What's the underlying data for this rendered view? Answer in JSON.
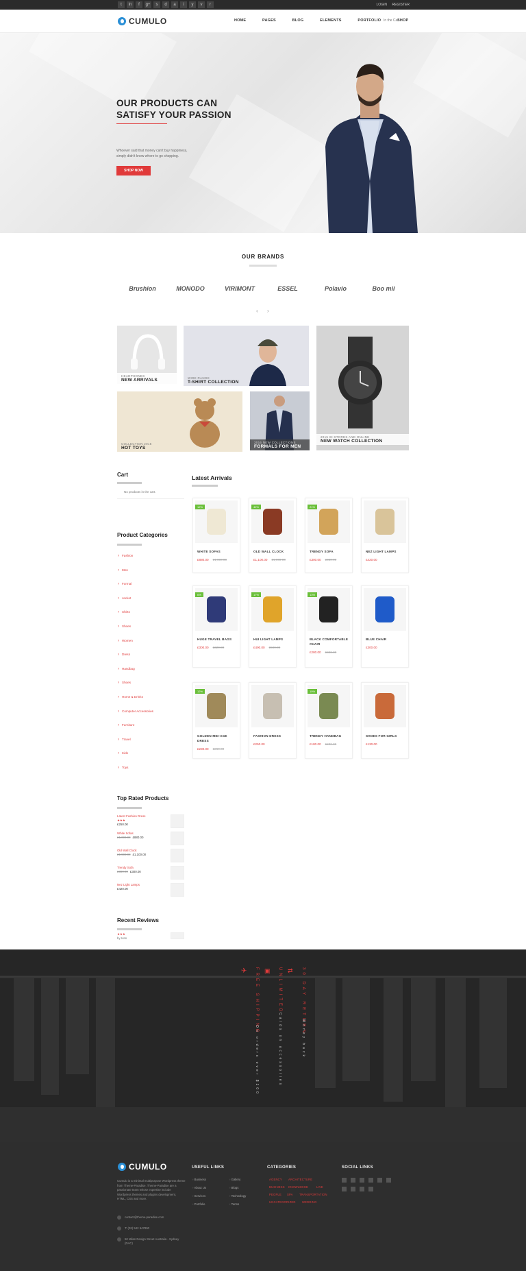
{
  "topbar": {
    "social_icons": [
      "twitter-icon",
      "linkedin-icon",
      "facebook-icon",
      "googleplus-icon",
      "skype-icon",
      "dribbble-icon",
      "apple-icon",
      "instagram-icon",
      "youtube-icon",
      "vimeo-icon",
      "rss-icon"
    ],
    "login": "LOGIN",
    "register": "REGISTER"
  },
  "nav": {
    "logo": "CUMULO",
    "menu": [
      "HOME",
      "PAGES",
      "BLOG",
      "ELEMENTS",
      "PORTFOLIO",
      "SHOP"
    ],
    "cart": "In the Cart"
  },
  "hero": {
    "title": "OUR PRODUCTS CAN SATISFY YOUR PASSION",
    "text": "Whoever said that money can't buy happiness, simply didn't know where to go shopping.",
    "button": "SHOP NOW"
  },
  "brands": {
    "title": "OUR BRANDS",
    "items": [
      "Brushion",
      "MONODO",
      "VIRIMONT",
      "ESSEL",
      "Polavio",
      "Boo mii"
    ]
  },
  "tiles": [
    {
      "sub": "HEADPHONES",
      "title": "NEW ARRIVALS"
    },
    {
      "sub": "WIDE RANGE",
      "title": "T-SHIRT COLLECTION"
    },
    {
      "sub": "2015 IN STORES AND ONLINE",
      "title": "NEW WATCH COLLECTION"
    },
    {
      "sub": "COLLECTION 2015",
      "title": "HOT TOYS"
    },
    {
      "sub": "2016 NEW COLLECTIONS",
      "title": "FORMALS FOR MEN"
    }
  ],
  "sidebar": {
    "cart_title": "Cart",
    "cart_empty": "No products in the cart.",
    "categories_title": "Product Categories",
    "categories": [
      "Fashion",
      "Men",
      "Formal",
      "Jacket",
      "Shirts",
      "Shoes",
      "Women",
      "Dress",
      "Handbag",
      "Shoes",
      "Home & Drinks",
      "Computer Accessories",
      "Furniture",
      "Travel",
      "Kids",
      "Toys"
    ],
    "top_rated_title": "Top Rated Products",
    "top_rated": [
      {
        "name": "Latest Fashion Dress",
        "stars": "★★★",
        "price": "£250.00"
      },
      {
        "name": "White Sofas",
        "old": "£1,000.00",
        "price": "£880.00"
      },
      {
        "name": "Old Wall Clock",
        "old": "£1,900.00",
        "price": "£1,100.00"
      },
      {
        "name": "Trendy Sofa",
        "old": "£380.00",
        "price": "£300.00"
      },
      {
        "name": "Nez Light Lamps",
        "price": "£420.00"
      }
    ],
    "reviews_title": "Recent Reviews",
    "review_stars": "★★★",
    "review_by": "by Ivan"
  },
  "arrivals": {
    "title": "Latest Arrivals",
    "products": [
      {
        "name": "WHITE SOFAS",
        "price": "£880.00",
        "old": "£1,000.00",
        "badge": "12%"
      },
      {
        "name": "OLD WALL CLOCK",
        "price": "£1,100.00",
        "old": "£1,900.00",
        "badge": "42%"
      },
      {
        "name": "TRENDY SOFA",
        "price": "£300.00",
        "old": "£380.00",
        "badge": "21%"
      },
      {
        "name": "NEZ LIGHT LAMPS",
        "price": "£420.00",
        "old": "",
        "badge": ""
      },
      {
        "name": "HUGE TRAVEL BAGS",
        "price": "£300.00",
        "old": "£320.00",
        "badge": "6%"
      },
      {
        "name": "HUI LIGHT LAMPS",
        "price": "£490.00",
        "old": "£590.00",
        "badge": "17%"
      },
      {
        "name": "BLACK COMFORTABLE CHAIR",
        "price": "£280.00",
        "old": "£320.00",
        "badge": "13%"
      },
      {
        "name": "BLUE CHAIR",
        "price": "£300.00",
        "old": "",
        "badge": ""
      },
      {
        "name": "GOLDEN MID-AGE DRESS",
        "price": "£230.00",
        "old": "£260.00",
        "badge": "12%"
      },
      {
        "name": "FASHION DRESS",
        "price": "£250.00",
        "old": "",
        "badge": ""
      },
      {
        "name": "TRENDY HANDBAG",
        "price": "£180.00",
        "old": "£200.00",
        "badge": "10%"
      },
      {
        "name": "SHOES FOR GIRLS",
        "price": "£130.00",
        "old": "",
        "badge": ""
      }
    ]
  },
  "features": [
    {
      "title": "FREE SHIPPING",
      "sub": "On orders over $100"
    },
    {
      "title": "UNLIMITED",
      "sub": "Cards on accessories"
    },
    {
      "title": "30 DAY RETURN",
      "sub": "Money back"
    }
  ],
  "footer": {
    "logo": "CUMULO",
    "about": "Cumulo is a minimal multipurpose Wordpress theme from Theme-Paradise. Theme-Paradise are a passionate team whose expertise include Wordpress themes and plugins development, HTML, CSS and more.",
    "email": "contact@theme-paradise.com",
    "phone": "T: (02) 542 547890",
    "address": "50 Milan Design Street Australia - Sydney (DAC)",
    "useful_title": "USEFUL LINKS",
    "useful_col1": [
      "Business",
      "About Us",
      "Services",
      "Portfolio"
    ],
    "useful_col2": [
      "Gallery",
      "Blogs",
      "Technology",
      "Terms"
    ],
    "categories_title": "CATEGORIES",
    "categories": [
      "AGENCY",
      "ARCHITECTURE",
      "BUSINESS",
      "KNOWLEDGE",
      "LIVE",
      "PEOPLE",
      "SPA",
      "TRANSPORTATION",
      "UNCATEGORIZED",
      "WEDDING"
    ],
    "social_title": "SOCIAL LINKS"
  },
  "colors": {
    "accent": "#e03a3a",
    "badge": "#6abf3a",
    "dark": "#2e2e2e"
  }
}
